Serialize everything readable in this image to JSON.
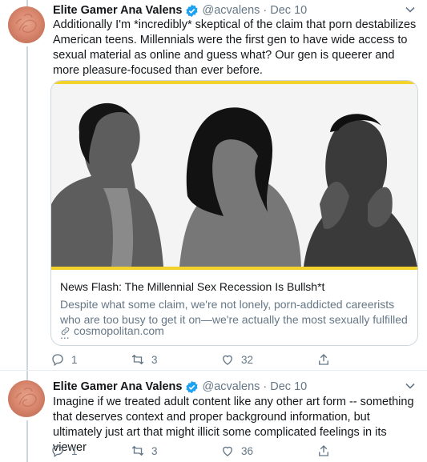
{
  "tweets": [
    {
      "name": "Elite Gamer Ana Valens",
      "handle": "@acvalens",
      "separator": "·",
      "date": "Dec 10",
      "text": "Additionally I'm *incredibly* skeptical of the claim that porn destabilizes American teens. Millennials were the first gen to have wide access to sexual material as online and guess what? Our gen is queerer and more pleasure-focused than ever before.",
      "card": {
        "title": "News Flash: The Millennial Sex Recession Is Bullsh*t",
        "description": "Despite what some claim, we're not lonely, porn-addicted careerists who are too busy to get it on—we're actually the most sexually fulfilled ...",
        "domain": "cosmopolitan.com"
      },
      "actions": {
        "replies": "1",
        "retweets": "3",
        "likes": "32"
      }
    },
    {
      "name": "Elite Gamer Ana Valens",
      "handle": "@acvalens",
      "separator": "·",
      "date": "Dec 10",
      "text": "Imagine if we treated adult content like any other art form -- something that deserves context and proper background information, but ultimately just art that might illicit some complicated feelings in its viewer",
      "actions": {
        "replies": "1",
        "retweets": "3",
        "likes": "36"
      }
    }
  ],
  "colors": {
    "verified": "#1da1f2",
    "thread_line": "#ccd6dd",
    "card_accent": "#f3d32b",
    "secondary_text": "#657786"
  },
  "icons": [
    "verified-badge-icon",
    "chevron-down-icon",
    "reply-icon",
    "retweet-icon",
    "like-icon",
    "share-icon",
    "link-icon"
  ]
}
